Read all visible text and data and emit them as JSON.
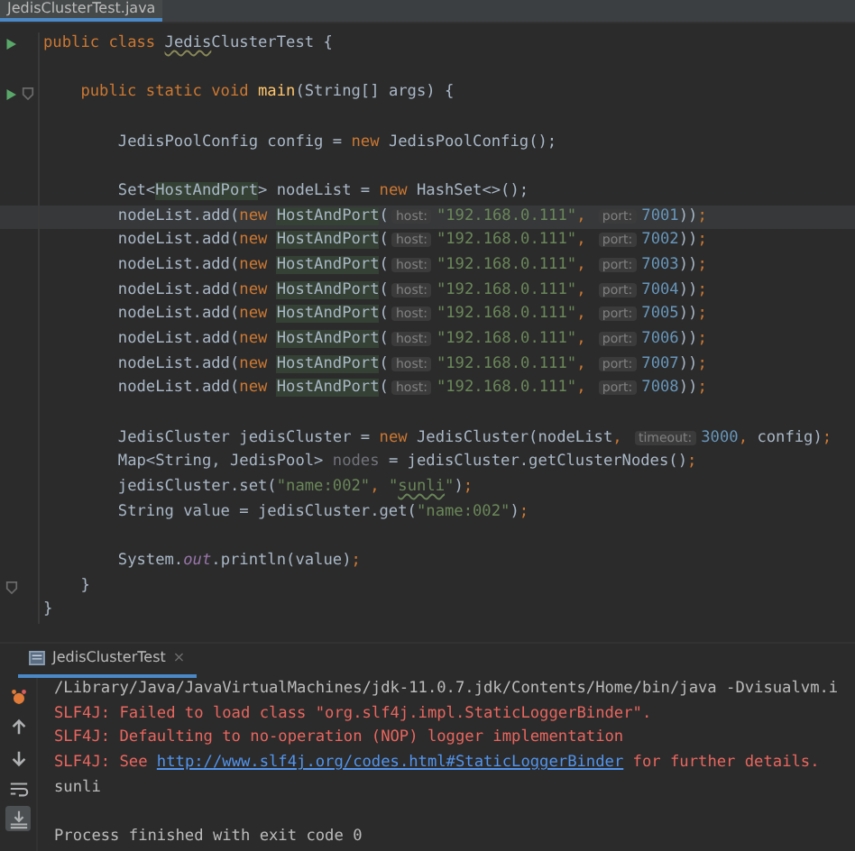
{
  "editor_tab": {
    "label": "JedisClusterTest.java",
    "selected": true
  },
  "code": [
    {
      "kind": "code",
      "run": true,
      "tokens": [
        {
          "kind": "keyword",
          "text": "public class "
        },
        {
          "kind": "typo",
          "text": "Jedis"
        },
        {
          "kind": "plain",
          "text": "ClusterTest {"
        }
      ],
      "children": [
        {
          "kind": "blank"
        },
        {
          "kind": "code",
          "run": true,
          "fold": true,
          "tokens": [
            {
              "kind": "keyword",
              "text": "public static void "
            },
            {
              "kind": "method",
              "text": "main"
            },
            {
              "kind": "plain",
              "text": "(String[] args) {"
            }
          ],
          "children": [
            {
              "kind": "blank"
            },
            {
              "kind": "code",
              "tokens": [
                {
                  "kind": "plain",
                  "text": "JedisPoolConfig config = "
                },
                {
                  "kind": "keyword",
                  "text": "new"
                },
                {
                  "kind": "plain",
                  "text": " JedisPoolConfig();"
                }
              ]
            },
            {
              "kind": "blank"
            },
            {
              "kind": "code",
              "tokens": [
                {
                  "kind": "plain",
                  "text": "Set<"
                },
                {
                  "kind": "highlight",
                  "text": "HostAndPort"
                },
                {
                  "kind": "plain",
                  "text": "> nodeList = "
                },
                {
                  "kind": "keyword",
                  "text": "new"
                },
                {
                  "kind": "plain",
                  "text": " HashSet<>();"
                }
              ]
            },
            {
              "kind": "code",
              "current": true,
              "tokens": [
                {
                  "kind": "plain",
                  "text": "nodeList.add("
                },
                {
                  "kind": "keyword",
                  "text": "new "
                },
                {
                  "kind": "highlight",
                  "text": "HostAndPort"
                },
                {
                  "kind": "plain",
                  "text": "("
                },
                {
                  "kind": "hint",
                  "text": "host:"
                },
                {
                  "kind": "string",
                  "text": "\"192.168.0.111\""
                },
                {
                  "kind": "keyword",
                  "text": ", "
                },
                {
                  "kind": "hint",
                  "text": "port:"
                },
                {
                  "kind": "number",
                  "text": "7001"
                },
                {
                  "kind": "plain",
                  "text": "))"
                },
                {
                  "kind": "keyword",
                  "text": ";"
                }
              ]
            },
            {
              "kind": "code",
              "tokens": [
                {
                  "kind": "plain",
                  "text": "nodeList.add("
                },
                {
                  "kind": "keyword",
                  "text": "new "
                },
                {
                  "kind": "highlight",
                  "text": "HostAndPort"
                },
                {
                  "kind": "plain",
                  "text": "("
                },
                {
                  "kind": "hint",
                  "text": "host:"
                },
                {
                  "kind": "string",
                  "text": "\"192.168.0.111\""
                },
                {
                  "kind": "keyword",
                  "text": ", "
                },
                {
                  "kind": "hint",
                  "text": "port:"
                },
                {
                  "kind": "number",
                  "text": "7002"
                },
                {
                  "kind": "plain",
                  "text": "))"
                },
                {
                  "kind": "keyword",
                  "text": ";"
                }
              ]
            },
            {
              "kind": "code",
              "tokens": [
                {
                  "kind": "plain",
                  "text": "nodeList.add("
                },
                {
                  "kind": "keyword",
                  "text": "new "
                },
                {
                  "kind": "highlight",
                  "text": "HostAndPort"
                },
                {
                  "kind": "plain",
                  "text": "("
                },
                {
                  "kind": "hint",
                  "text": "host:"
                },
                {
                  "kind": "string",
                  "text": "\"192.168.0.111\""
                },
                {
                  "kind": "keyword",
                  "text": ", "
                },
                {
                  "kind": "hint",
                  "text": "port:"
                },
                {
                  "kind": "number",
                  "text": "7003"
                },
                {
                  "kind": "plain",
                  "text": "))"
                },
                {
                  "kind": "keyword",
                  "text": ";"
                }
              ]
            },
            {
              "kind": "code",
              "tokens": [
                {
                  "kind": "plain",
                  "text": "nodeList.add("
                },
                {
                  "kind": "keyword",
                  "text": "new "
                },
                {
                  "kind": "highlight",
                  "text": "HostAndPort"
                },
                {
                  "kind": "plain",
                  "text": "("
                },
                {
                  "kind": "hint",
                  "text": "host:"
                },
                {
                  "kind": "string",
                  "text": "\"192.168.0.111\""
                },
                {
                  "kind": "keyword",
                  "text": ", "
                },
                {
                  "kind": "hint",
                  "text": "port:"
                },
                {
                  "kind": "number",
                  "text": "7004"
                },
                {
                  "kind": "plain",
                  "text": "))"
                },
                {
                  "kind": "keyword",
                  "text": ";"
                }
              ]
            },
            {
              "kind": "code",
              "tokens": [
                {
                  "kind": "plain",
                  "text": "nodeList.add("
                },
                {
                  "kind": "keyword",
                  "text": "new "
                },
                {
                  "kind": "highlight",
                  "text": "HostAndPort"
                },
                {
                  "kind": "plain",
                  "text": "("
                },
                {
                  "kind": "hint",
                  "text": "host:"
                },
                {
                  "kind": "string",
                  "text": "\"192.168.0.111\""
                },
                {
                  "kind": "keyword",
                  "text": ", "
                },
                {
                  "kind": "hint",
                  "text": "port:"
                },
                {
                  "kind": "number",
                  "text": "7005"
                },
                {
                  "kind": "plain",
                  "text": "))"
                },
                {
                  "kind": "keyword",
                  "text": ";"
                }
              ]
            },
            {
              "kind": "code",
              "tokens": [
                {
                  "kind": "plain",
                  "text": "nodeList.add("
                },
                {
                  "kind": "keyword",
                  "text": "new "
                },
                {
                  "kind": "highlight",
                  "text": "HostAndPort"
                },
                {
                  "kind": "plain",
                  "text": "("
                },
                {
                  "kind": "hint",
                  "text": "host:"
                },
                {
                  "kind": "string",
                  "text": "\"192.168.0.111\""
                },
                {
                  "kind": "keyword",
                  "text": ", "
                },
                {
                  "kind": "hint",
                  "text": "port:"
                },
                {
                  "kind": "number",
                  "text": "7006"
                },
                {
                  "kind": "plain",
                  "text": "))"
                },
                {
                  "kind": "keyword",
                  "text": ";"
                }
              ]
            },
            {
              "kind": "code",
              "tokens": [
                {
                  "kind": "plain",
                  "text": "nodeList.add("
                },
                {
                  "kind": "keyword",
                  "text": "new "
                },
                {
                  "kind": "highlight",
                  "text": "HostAndPort"
                },
                {
                  "kind": "plain",
                  "text": "("
                },
                {
                  "kind": "hint",
                  "text": "host:"
                },
                {
                  "kind": "string",
                  "text": "\"192.168.0.111\""
                },
                {
                  "kind": "keyword",
                  "text": ", "
                },
                {
                  "kind": "hint",
                  "text": "port:"
                },
                {
                  "kind": "number",
                  "text": "7007"
                },
                {
                  "kind": "plain",
                  "text": "))"
                },
                {
                  "kind": "keyword",
                  "text": ";"
                }
              ]
            },
            {
              "kind": "code",
              "tokens": [
                {
                  "kind": "plain",
                  "text": "nodeList.add("
                },
                {
                  "kind": "keyword",
                  "text": "new "
                },
                {
                  "kind": "highlight",
                  "text": "HostAndPort"
                },
                {
                  "kind": "plain",
                  "text": "("
                },
                {
                  "kind": "hint",
                  "text": "host:"
                },
                {
                  "kind": "string",
                  "text": "\"192.168.0.111\""
                },
                {
                  "kind": "keyword",
                  "text": ", "
                },
                {
                  "kind": "hint",
                  "text": "port:"
                },
                {
                  "kind": "number",
                  "text": "7008"
                },
                {
                  "kind": "plain",
                  "text": "))"
                },
                {
                  "kind": "keyword",
                  "text": ";"
                }
              ]
            },
            {
              "kind": "blank"
            },
            {
              "kind": "code",
              "tokens": [
                {
                  "kind": "plain",
                  "text": "JedisCluster jedisCluster = "
                },
                {
                  "kind": "keyword",
                  "text": "new"
                },
                {
                  "kind": "plain",
                  "text": " JedisCluster(nodeList"
                },
                {
                  "kind": "keyword",
                  "text": ", "
                },
                {
                  "kind": "hint",
                  "text": "timeout:"
                },
                {
                  "kind": "number",
                  "text": "3000"
                },
                {
                  "kind": "keyword",
                  "text": ", "
                },
                {
                  "kind": "plain",
                  "text": "config)"
                },
                {
                  "kind": "keyword",
                  "text": ";"
                }
              ]
            },
            {
              "kind": "code",
              "tokens": [
                {
                  "kind": "plain",
                  "text": "Map<String, JedisPool> "
                },
                {
                  "kind": "unused",
                  "text": "nodes"
                },
                {
                  "kind": "plain",
                  "text": " = jedisCluster.getClusterNodes()"
                },
                {
                  "kind": "keyword",
                  "text": ";"
                }
              ]
            },
            {
              "kind": "code",
              "tokens": [
                {
                  "kind": "plain",
                  "text": "jedisCluster.set("
                },
                {
                  "kind": "string",
                  "text": "\"name:002\""
                },
                {
                  "kind": "keyword",
                  "text": ", "
                },
                {
                  "kind": "string",
                  "text": "\""
                },
                {
                  "kind": "string-typo",
                  "text": "sunli"
                },
                {
                  "kind": "string",
                  "text": "\""
                },
                {
                  "kind": "plain",
                  "text": ")"
                },
                {
                  "kind": "keyword",
                  "text": ";"
                }
              ]
            },
            {
              "kind": "code",
              "tokens": [
                {
                  "kind": "plain",
                  "text": "String value = jedisCluster.get("
                },
                {
                  "kind": "string",
                  "text": "\"name:002\""
                },
                {
                  "kind": "plain",
                  "text": ")"
                },
                {
                  "kind": "keyword",
                  "text": ";"
                }
              ]
            },
            {
              "kind": "blank"
            },
            {
              "kind": "code",
              "tokens": [
                {
                  "kind": "plain",
                  "text": "System."
                },
                {
                  "kind": "field",
                  "text": "out"
                },
                {
                  "kind": "plain",
                  "text": ".println(value)"
                },
                {
                  "kind": "keyword",
                  "text": ";"
                }
              ]
            }
          ]
        },
        {
          "kind": "code",
          "fold": true,
          "tokens": [
            {
              "kind": "plain",
              "text": "}"
            }
          ]
        }
      ]
    },
    {
      "kind": "code",
      "tokens": [
        {
          "kind": "plain",
          "text": "}"
        }
      ]
    }
  ],
  "console_tab": {
    "label": "JedisClusterTest",
    "close": "×",
    "selected": true
  },
  "console_lines": [
    {
      "kind": "text",
      "parts": [
        {
          "kind": "command",
          "text": "/Library/Java/JavaVirtualMachines/jdk-11.0.7.jdk/Contents/Home/bin/java -Dvisualvm.i"
        }
      ]
    },
    {
      "kind": "text",
      "parts": [
        {
          "kind": "error",
          "text": "SLF4J: Failed to load class \"org.slf4j.impl.StaticLoggerBinder\"."
        }
      ]
    },
    {
      "kind": "text",
      "parts": [
        {
          "kind": "error",
          "text": "SLF4J: Defaulting to no-operation (NOP) logger implementation"
        }
      ]
    },
    {
      "kind": "text",
      "parts": [
        {
          "kind": "error",
          "text": "SLF4J: See "
        },
        {
          "kind": "link",
          "text": "http://www.slf4j.org/codes.html#StaticLoggerBinder"
        },
        {
          "kind": "error",
          "text": " for further details."
        }
      ]
    },
    {
      "kind": "text",
      "parts": [
        {
          "kind": "output",
          "text": "sunli"
        }
      ]
    },
    {
      "kind": "blank"
    },
    {
      "kind": "text",
      "parts": [
        {
          "kind": "output",
          "text": "Process finished with exit code 0"
        }
      ]
    }
  ],
  "console_tools": [
    {
      "kind": "bug",
      "selected": false
    },
    {
      "kind": "up",
      "selected": false
    },
    {
      "kind": "down",
      "selected": false
    },
    {
      "kind": "wrap",
      "selected": false
    },
    {
      "kind": "scroll-end",
      "selected": true
    }
  ]
}
